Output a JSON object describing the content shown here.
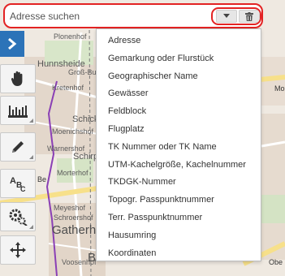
{
  "search": {
    "placeholder": "Adresse suchen",
    "toggle_icon": "caret-down-icon",
    "clear_icon": "trash-icon"
  },
  "toolbar": {
    "expand_icon": "chevron-right-icon",
    "tools": [
      {
        "name": "pan-tool",
        "icon": "hand-icon"
      },
      {
        "name": "measure-tool",
        "icon": "ruler-icon"
      },
      {
        "name": "draw-tool",
        "icon": "pencil-icon"
      },
      {
        "name": "text-tool",
        "icon": "abc-icon"
      },
      {
        "name": "settings-tool",
        "icon": "gears-icon"
      },
      {
        "name": "move-tool",
        "icon": "move-arrows-icon"
      }
    ]
  },
  "menu": {
    "items": [
      "Adresse",
      "Gemarkung oder Flurstück",
      "Geographischer Name",
      "Gewässer",
      "Feldblock",
      "Flugplatz",
      "TK Nummer oder TK Name",
      "UTM-Kachelgröße, Kachelnummer",
      "TKDGK-Nummer",
      "Topogr. Passpunktnummer",
      "Terr. Passpunktnummer",
      "Hausumring",
      "Koordinaten"
    ]
  },
  "map": {
    "places": {
      "plonenhof": "Plonenhof",
      "hunnsheide": "Hunnsheide",
      "gross_bud": "Groß-Bud",
      "kretenhof": "Kretenhof",
      "schicks": "Schicks",
      "moenichshof": "Moenichshof",
      "warnershof": "Warnershof",
      "schirp": "Schirp",
      "morterhof": "Morterhof",
      "meyeshof": "Meyeshof",
      "schroershof": "Schroershof",
      "gatherhof": "Gatherhof",
      "voosenhof": "Voosenhof",
      "b": "B",
      "mo": "Mo",
      "obe": "Obe",
      "be": "Be"
    }
  }
}
